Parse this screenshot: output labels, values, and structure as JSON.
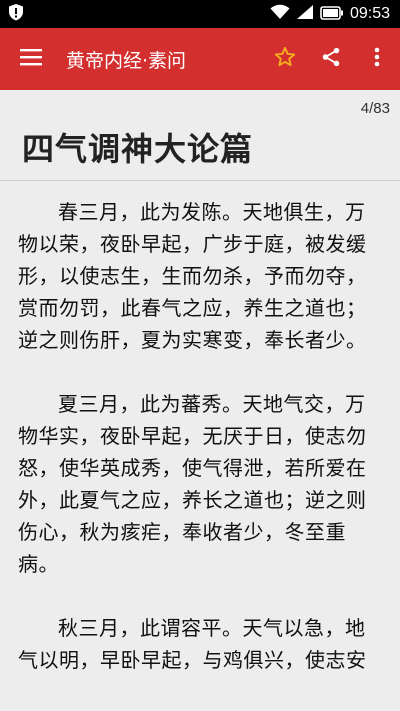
{
  "status_bar": {
    "time": "09:53"
  },
  "app_bar": {
    "title": "黄帝内经·素问"
  },
  "reader": {
    "page_indicator": "4/83",
    "chapter_title": "四气调神大论篇",
    "paragraphs": [
      "春三月，此为发陈。天地俱生，万物以荣，夜卧早起，广步于庭，被发缓形，以使志生，生而勿杀，予而勿夺，赏而勿罚，此春气之应，养生之道也；逆之则伤肝，夏为实寒变，奉长者少。",
      "夏三月，此为蕃秀。天地气交，万物华实，夜卧早起，无厌于日，使志勿怒，使华英成秀，使气得泄，若所爱在外，此夏气之应，养长之道也；逆之则伤心，秋为痎疟，奉收者少，冬至重病。",
      "秋三月，此谓容平。天气以急，地气以明，早卧早起，与鸡俱兴，使志安"
    ]
  },
  "colors": {
    "app_bar": "#d32f2f",
    "star_icon": "#f6b21e",
    "background": "#ededed"
  }
}
